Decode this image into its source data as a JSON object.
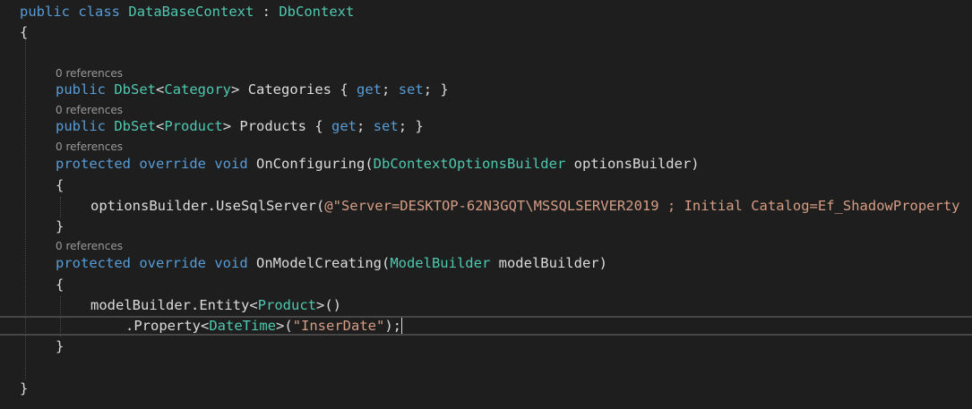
{
  "code": {
    "l1": {
      "kw_public": "public",
      "kw_class": "class",
      "name": "DataBaseContext",
      "colon": " : ",
      "base": "DbContext"
    },
    "l2": {
      "brace": "{"
    },
    "lens1": "0 references",
    "l3": {
      "kw_public": "public",
      "type": "DbSet",
      "lt": "<",
      "arg": "Category",
      "gt": ">",
      "name": " Categories { ",
      "get": "get",
      "semi1": "; ",
      "set": "set",
      "semi2": "; }"
    },
    "lens2": "0 references",
    "l4": {
      "kw_public": "public",
      "type": "DbSet",
      "lt": "<",
      "arg": "Product",
      "gt": ">",
      "name": " Products { ",
      "get": "get",
      "semi1": "; ",
      "set": "set",
      "semi2": "; }"
    },
    "lens3": "0 references",
    "l5": {
      "kw_protected": "protected",
      "kw_override": "override",
      "kw_void": "void",
      "method": " OnConfiguring(",
      "ptype": "DbContextOptionsBuilder",
      "pname": " optionsBuilder)"
    },
    "l6": {
      "brace": "{"
    },
    "l7": {
      "call": "optionsBuilder.UseSqlServer(",
      "str": "@\"Server=DESKTOP-62N3GQT\\MSSQLSERVER2019 ; Initial Catalog=Ef_ShadowProperty"
    },
    "l8": {
      "brace": "}"
    },
    "lens4": "0 references",
    "l9": {
      "kw_protected": "protected",
      "kw_override": "override",
      "kw_void": "void",
      "method": " OnModelCreating(",
      "ptype": "ModelBuilder",
      "pname": " modelBuilder)"
    },
    "l10": {
      "brace": "{"
    },
    "l11": {
      "call": "modelBuilder.Entity",
      "lt": "<",
      "arg": "Product",
      "gt": ">",
      "rest": "()"
    },
    "l12": {
      "call": ".Property",
      "lt": "<",
      "arg": "DateTime",
      "gt": ">",
      "open": "(",
      "str": "\"InserDate\"",
      "close": ");"
    },
    "l13": {
      "brace": "}"
    },
    "l14": {
      "brace": "}"
    }
  },
  "colors": {
    "background": "#1e1e1e",
    "keyword": "#569cd6",
    "type": "#4ec9b0",
    "string": "#d69d85",
    "plain": "#dcdcdc",
    "codelens": "#999999"
  }
}
